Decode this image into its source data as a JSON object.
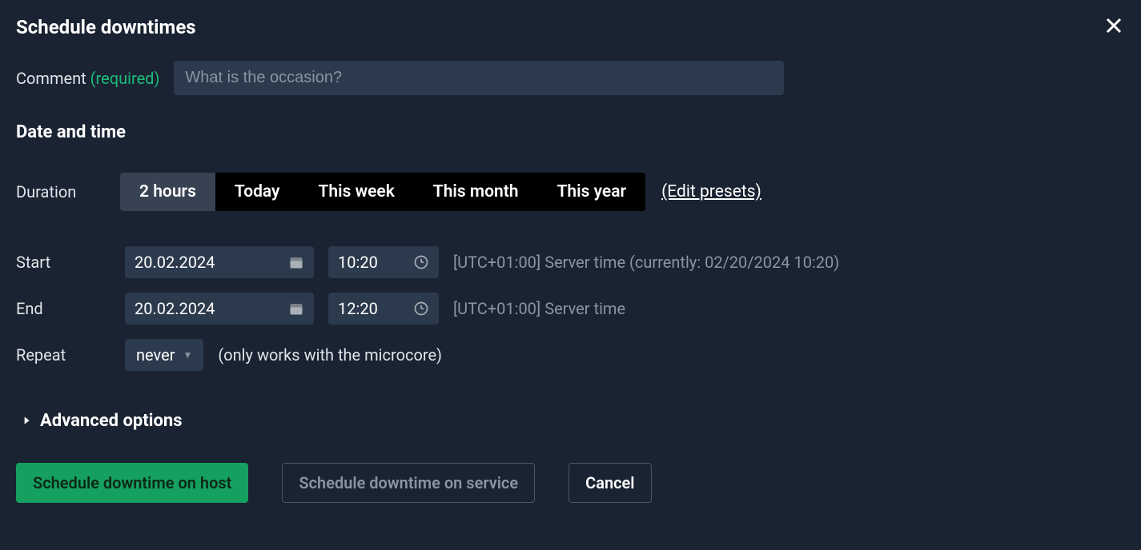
{
  "title": "Schedule downtimes",
  "comment": {
    "label": "Comment",
    "required": "(required)",
    "placeholder": "What is the occasion?",
    "value": ""
  },
  "section_datetime": "Date and time",
  "duration": {
    "label": "Duration",
    "presets": [
      {
        "label": "2 hours",
        "active": true
      },
      {
        "label": "Today",
        "active": false
      },
      {
        "label": "This week",
        "active": false
      },
      {
        "label": "This month",
        "active": false
      },
      {
        "label": "This year",
        "active": false
      }
    ],
    "edit_link": "(Edit presets)"
  },
  "start": {
    "label": "Start",
    "date": "20.02.2024",
    "time": "10:20",
    "tz": "[UTC+01:00] Server time (currently: 02/20/2024 10:20)"
  },
  "end": {
    "label": "End",
    "date": "20.02.2024",
    "time": "12:20",
    "tz": "[UTC+01:00] Server time"
  },
  "repeat": {
    "label": "Repeat",
    "value": "never",
    "hint": "(only works with the microcore)"
  },
  "advanced_label": "Advanced options",
  "buttons": {
    "primary": "Schedule downtime on host",
    "secondary": "Schedule downtime on service",
    "cancel": "Cancel"
  }
}
